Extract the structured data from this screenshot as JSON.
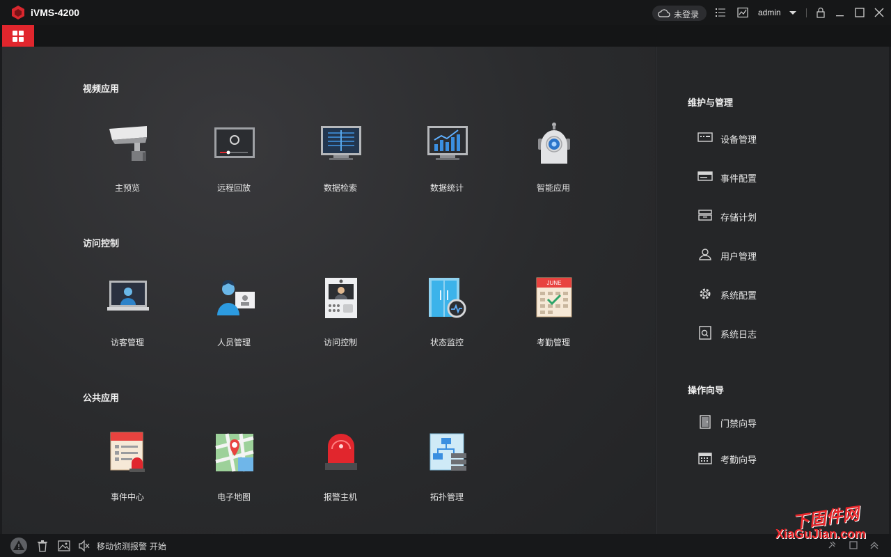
{
  "app": {
    "title": "iVMS-4200"
  },
  "titlebar": {
    "cloud_status": "未登录",
    "user": "admin"
  },
  "sections": [
    {
      "title": "视频应用",
      "tiles": [
        {
          "label": "主预览",
          "icon": "camera-icon"
        },
        {
          "label": "远程回放",
          "icon": "playback-icon"
        },
        {
          "label": "数据检索",
          "icon": "search-monitor-icon"
        },
        {
          "label": "数据统计",
          "icon": "statistics-icon"
        },
        {
          "label": "智能应用",
          "icon": "robot-icon"
        }
      ]
    },
    {
      "title": "访问控制",
      "tiles": [
        {
          "label": "访客管理",
          "icon": "visitor-icon"
        },
        {
          "label": "人员管理",
          "icon": "person-card-icon"
        },
        {
          "label": "访问控制",
          "icon": "door-intercom-icon"
        },
        {
          "label": "状态监控",
          "icon": "door-status-icon"
        },
        {
          "label": "考勤管理",
          "icon": "calendar-icon",
          "calendar_text": "JUNE"
        }
      ]
    },
    {
      "title": "公共应用",
      "tiles": [
        {
          "label": "事件中心",
          "icon": "event-center-icon"
        },
        {
          "label": "电子地图",
          "icon": "map-icon"
        },
        {
          "label": "报警主机",
          "icon": "alarm-light-icon"
        },
        {
          "label": "拓扑管理",
          "icon": "topology-icon"
        }
      ]
    }
  ],
  "right_panel": {
    "maintenance_title": "维护与管理",
    "maintenance_items": [
      {
        "label": "设备管理",
        "icon": "device-icon"
      },
      {
        "label": "事件配置",
        "icon": "event-config-icon"
      },
      {
        "label": "存储计划",
        "icon": "storage-icon"
      },
      {
        "label": "用户管理",
        "icon": "user-icon"
      },
      {
        "label": "系统配置",
        "icon": "gear-icon"
      },
      {
        "label": "系统日志",
        "icon": "log-icon"
      }
    ],
    "guide_title": "操作向导",
    "guide_items": [
      {
        "label": "门禁向导",
        "icon": "door-guide-icon"
      },
      {
        "label": "考勤向导",
        "icon": "attendance-guide-icon"
      }
    ]
  },
  "statusbar": {
    "message": "移动侦测报警 开始"
  },
  "watermark": {
    "cn": "下固件网",
    "en": "XiaGuJian.com"
  },
  "colors": {
    "accent": "#e1262d",
    "background": "#2a2b2d",
    "panel": "#252628"
  }
}
